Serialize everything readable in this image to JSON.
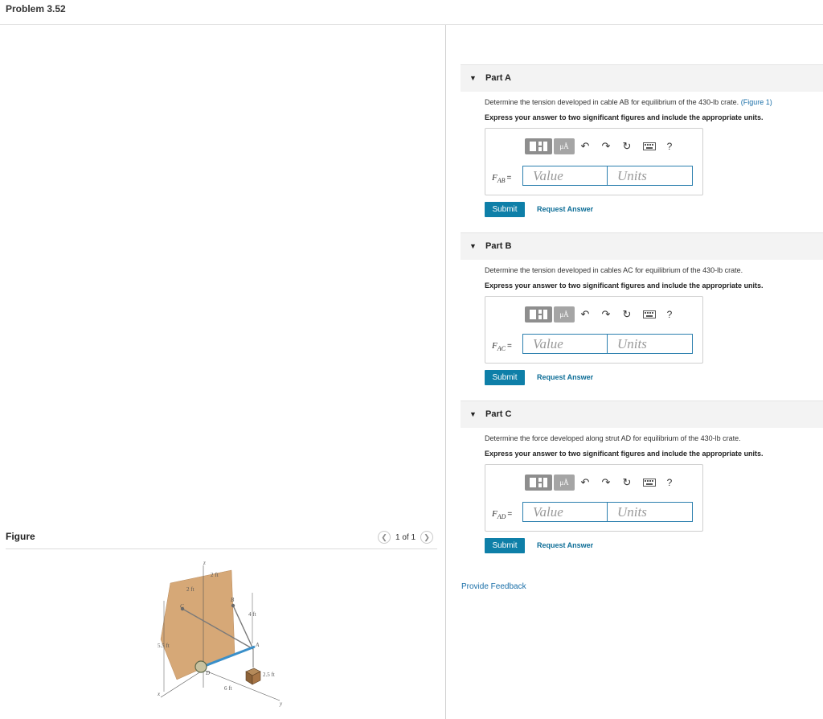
{
  "page": {
    "title": "Problem 3.52"
  },
  "figure": {
    "label": "Figure",
    "pager": {
      "prev_icon": "chevron-left",
      "next_icon": "chevron-right",
      "text": "1 of 1"
    },
    "labels": {
      "dim_2ft_top": "2 ft",
      "dim_2ft_left": "2 ft",
      "dim_4ft": "4 ft",
      "dim_5_5ft": "5.5 ft",
      "dim_2_5ft": "2.5 ft",
      "dim_6ft": "6 ft",
      "axis_z": "z",
      "axis_x": "x",
      "axis_y": "y",
      "point_a": "A",
      "point_b": "B",
      "point_c": "C",
      "point_d": "D"
    }
  },
  "toolbar": {
    "units_label": "μÅ",
    "help_label": "?",
    "icons": [
      "templates-icon",
      "units-icon",
      "undo-icon",
      "redo-icon",
      "reset-icon",
      "keyboard-icon",
      "help-icon"
    ]
  },
  "parts": [
    {
      "title": "Part A",
      "question": "Determine the tension developed in cable AB for equilibrium of the 430-lb crate.",
      "figure_link": "(Figure 1)",
      "instruction": "Express your answer to two significant figures and include the appropriate units.",
      "var_symbol": "F",
      "var_sub": "AB",
      "var_eq": "=",
      "value_placeholder": "Value",
      "units_placeholder": "Units",
      "submit_label": "Submit",
      "request_label": "Request Answer"
    },
    {
      "title": "Part B",
      "question": "Determine the tension developed in cables AC for equilibrium of the 430-lb crate.",
      "figure_link": "",
      "instruction": "Express your answer to two significant figures and include the appropriate units.",
      "var_symbol": "F",
      "var_sub": "AC",
      "var_eq": "=",
      "value_placeholder": "Value",
      "units_placeholder": "Units",
      "submit_label": "Submit",
      "request_label": "Request Answer"
    },
    {
      "title": "Part C",
      "question": "Determine the force developed along strut AD for equilibrium of the 430-lb crate.",
      "figure_link": "",
      "instruction": "Express your answer to two significant figures and include the appropriate units.",
      "var_symbol": "F",
      "var_sub": "AD",
      "var_eq": "=",
      "value_placeholder": "Value",
      "units_placeholder": "Units",
      "submit_label": "Submit",
      "request_label": "Request Answer"
    }
  ],
  "feedback": {
    "label": "Provide Feedback"
  }
}
